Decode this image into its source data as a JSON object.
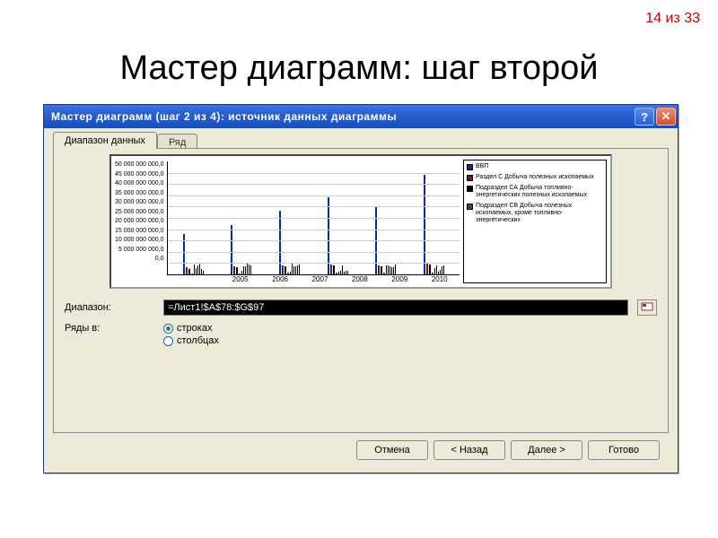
{
  "slide": {
    "counter": "14 из 33",
    "title": "Мастер диаграмм: шаг второй"
  },
  "dialog": {
    "titlebar": "Мастер диаграмм (шаг 2 из 4): источник данных диаграммы",
    "help_icon": "?",
    "close_icon": "✕",
    "tabs": {
      "range": "Диапазон данных",
      "series": "Ряд"
    },
    "form": {
      "range_label": "Диапазон:",
      "range_value": "=Лист1!$A$78:$G$97",
      "rows_in_label": "Ряды в:",
      "radio_rows": "строках",
      "radio_cols": "столбцах",
      "radio_selected": "rows"
    },
    "buttons": {
      "cancel": "Отмена",
      "back": "< Назад",
      "next": "Далее >",
      "finish": "Готово"
    }
  },
  "chart_data": {
    "type": "bar",
    "title": "",
    "xlabel": "",
    "ylabel": "",
    "ylim": [
      0,
      50000000000
    ],
    "y_ticks": [
      "50 000 000 000,0",
      "45 000 000 000,0",
      "40 000 000 000,0",
      "35 000 000 000,0",
      "30 000 000 000,0",
      "25 000 000 000,0",
      "20 000 000 000,0",
      "15 000 000 000,0",
      "10 000 000 000,0",
      "5 000 000 000,0",
      "0,0"
    ],
    "categories": [
      "2005",
      "2006",
      "2007",
      "2008",
      "2009",
      "2010"
    ],
    "series": [
      {
        "name": "ВВП",
        "color": "#0030a0",
        "values": [
          18000000000,
          22000000000,
          28000000000,
          34000000000,
          30000000000,
          44000000000
        ]
      },
      {
        "name": "Раздел С Добыча полезных ископаемых",
        "color": "#701030",
        "values": [
          3000000000,
          3500000000,
          4000000000,
          4500000000,
          4000000000,
          5000000000
        ]
      },
      {
        "name": "Подраздел СА Добыча топливно-энергетических полезных ископаемых",
        "color": "#000000",
        "values": [
          2500000000,
          3000000000,
          3500000000,
          4000000000,
          3500000000,
          4200000000
        ]
      },
      {
        "name": "Подраздел СВ Добыча полезных ископаемых, кроме топливно-энергетических",
        "color": "#305030",
        "values": [
          500000000,
          600000000,
          700000000,
          800000000,
          700000000,
          900000000
        ]
      }
    ]
  }
}
